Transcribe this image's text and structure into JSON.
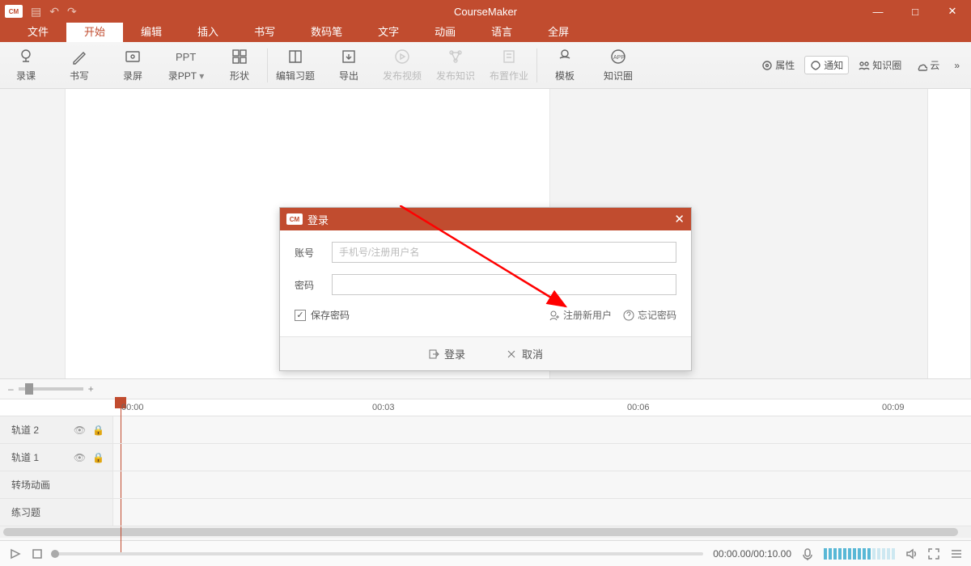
{
  "app": {
    "name": "CourseMaker",
    "logo_text": "CM"
  },
  "window_controls": {
    "minimize": "—",
    "maximize": "□",
    "close": "✕"
  },
  "qat": {
    "save": "💾",
    "undo": "↶",
    "redo": "↷"
  },
  "menus": {
    "file": "文件",
    "start": "开始",
    "edit": "编辑",
    "insert": "插入",
    "write": "书写",
    "pen": "数码笔",
    "text": "文字",
    "anim": "动画",
    "lang": "语言",
    "fullscreen": "全屏"
  },
  "ribbon": {
    "record": "录课",
    "write": "书写",
    "screenrec": "录屏",
    "ppt": "录PPT",
    "shape": "形状",
    "exercise": "编辑习题",
    "export": "导出",
    "pub_video": "发布视频",
    "pub_knowledge": "发布知识",
    "assign": "布置作业",
    "template": "模板",
    "circle": "知识圈",
    "dropdown": "▾"
  },
  "right_tools": {
    "props": "属性",
    "notify": "通知",
    "circle": "知识圈",
    "cloud": "云",
    "more": "»"
  },
  "timeline": {
    "ticks": [
      "00:00",
      "00:03",
      "00:06",
      "00:09"
    ],
    "tracks": {
      "t2": "轨道 2",
      "t1": "轨道 1",
      "transition": "转场动画",
      "exercise": "练习题"
    },
    "zoom_minus": "–",
    "zoom_plus": "+"
  },
  "status": {
    "time": "00:00.00/00:10.00"
  },
  "login": {
    "title": "登录",
    "account_label": "账号",
    "account_placeholder": "手机号/注册用户名",
    "password_label": "密码",
    "remember": "保存密码",
    "register": "注册新用户",
    "forgot": "忘记密码",
    "login_btn": "登录",
    "cancel_btn": "取消",
    "close": "✕"
  }
}
